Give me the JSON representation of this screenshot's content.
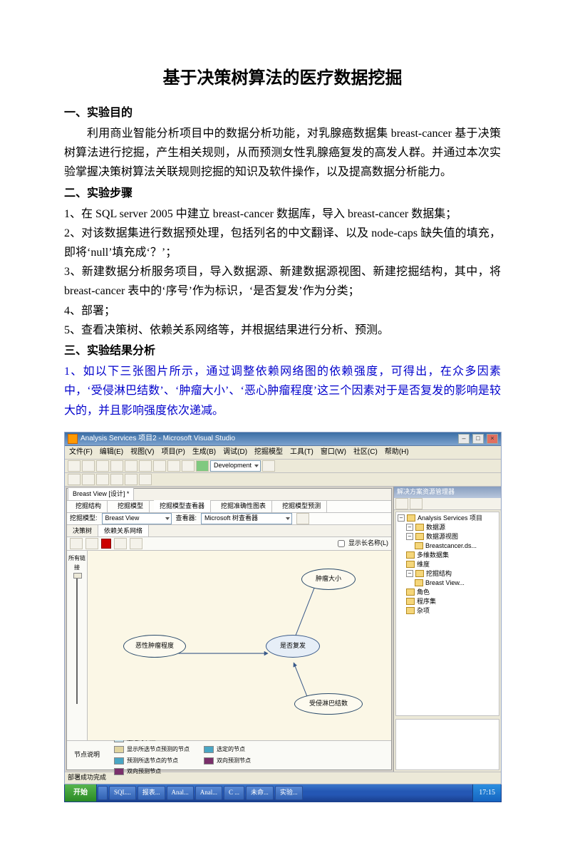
{
  "title": "基于决策树算法的医疗数据挖掘",
  "s1": {
    "heading": "一、实验目的",
    "p": "利用商业智能分析项目中的数据分析功能，对乳腺癌数据集 breast-cancer 基于决策树算法进行挖掘，产生相关规则，从而预测女性乳腺癌复发的高发人群。并通过本次实验掌握决策树算法关联规则挖掘的知识及软件操作，以及提高数据分析能力。"
  },
  "s2": {
    "heading": "二、实验步骤",
    "steps": [
      "1、在 SQL server 2005 中建立 breast-cancer 数据库，导入 breast-cancer 数据集；",
      "2、对该数据集进行数据预处理，包括列名的中文翻译、以及 node-caps 缺失值的填充，即将‘null’填充成‘？’；",
      "3、新建数据分析服务项目，导入数据源、新建数据源视图、新建挖掘结构，其中，将 breast-cancer 表中的‘序号’作为标识，‘是否复发’作为分类；",
      "4、部署；",
      "5、查看决策树、依赖关系网络等，并根据结果进行分析、预测。"
    ]
  },
  "s3": {
    "heading": "三、实验结果分析",
    "lead": "1、如以下三张图片所示，通过调整依赖网络图的依赖强度，可得出，在众多因素中，‘受侵淋巴结数’、‘肿瘤大小’、‘恶心肿瘤程度’这三个因素对于是否复发的影响是较大的，并且影响强度依次递减。"
  },
  "shot": {
    "window_title": "Analysis Services 项目2 - Microsoft Visual Studio",
    "menus": [
      "文件(F)",
      "编辑(E)",
      "视图(V)",
      "项目(P)",
      "生成(B)",
      "调试(D)",
      "挖掘模型",
      "工具(T)",
      "窗口(W)",
      "社区(C)",
      "帮助(H)"
    ],
    "toolbar_dropdown": "Development",
    "tab_label": "Breast View [设计] *",
    "design_tabs": [
      "挖掘结构",
      "挖掘模型",
      "挖掘模型查看器",
      "挖掘准确性图表",
      "挖掘模型预测"
    ],
    "subrow": {
      "label1": "挖掘模型:",
      "value1": "Breast View",
      "label2": "查看器:",
      "value2": "Microsoft 树查看器"
    },
    "subtabs": [
      "决策树",
      "依赖关系网络"
    ],
    "checkbox_label": "显示长名称(L)",
    "slider_label": "所有链接",
    "nodes": {
      "left": "恶性肿瘤程度",
      "center": "是否复发",
      "top": "肿瘤大小",
      "bottom": "受侵淋巴结数"
    },
    "legend_left_label": "节点说明",
    "legend_left_lines": [
      "选定的节点",
      "显示所选节点预测的节点",
      "预测所选节点的节点",
      "双向预测节点"
    ],
    "legend_colors": [
      "#c0dce8",
      "#e0d4a0",
      "#4aa6c4",
      "#7a2f6a"
    ],
    "legend_right_lines": [
      "选定的节点",
      "双向预测节点"
    ],
    "right_panel_title": "解决方案资源管理器",
    "tree_items": [
      {
        "ind": 0,
        "icon": "folder",
        "label": "Analysis Services 项目"
      },
      {
        "ind": 12,
        "icon": "folder",
        "label": "数据源"
      },
      {
        "ind": 24,
        "icon": "folder",
        "label": "数据源视图"
      },
      {
        "ind": 36,
        "icon": "folder",
        "label": "Breastcancer.ds..."
      },
      {
        "ind": 12,
        "icon": "folder",
        "label": "多维数据集"
      },
      {
        "ind": 12,
        "icon": "folder",
        "label": "维度"
      },
      {
        "ind": 12,
        "icon": "folder",
        "label": "挖掘结构"
      },
      {
        "ind": 24,
        "icon": "folder",
        "label": "Breast View..."
      },
      {
        "ind": 12,
        "icon": "folder",
        "label": "角色"
      },
      {
        "ind": 12,
        "icon": "folder",
        "label": "程序集"
      },
      {
        "ind": 12,
        "icon": "folder",
        "label": "杂项"
      }
    ],
    "status_left": "部署成功完成",
    "taskbar": {
      "start": "开始",
      "items": [
        "",
        "SQL...",
        "报表...",
        "Anal...",
        "Anal...",
        "C ...",
        "未命...",
        "实验..."
      ],
      "clock": "17:15"
    }
  }
}
